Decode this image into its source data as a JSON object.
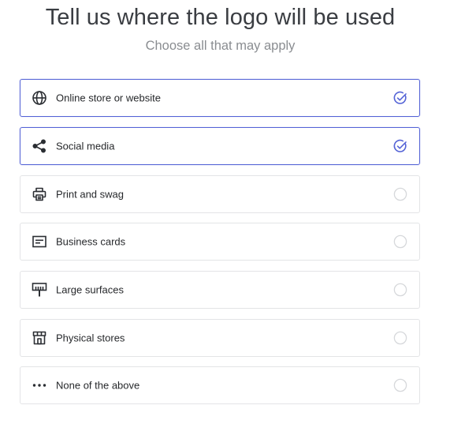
{
  "header": {
    "title": "Tell us where the logo will be used",
    "subtitle": "Choose all that may apply"
  },
  "colors": {
    "accent": "#5463d6",
    "border": "#e3e4e6",
    "icon": "#2b2e33",
    "unchecked": "#d6d8db"
  },
  "options": [
    {
      "label": "Online store or website",
      "icon": "globe-icon",
      "selected": true
    },
    {
      "label": "Social media",
      "icon": "share-icon",
      "selected": true
    },
    {
      "label": "Print and swag",
      "icon": "printer-icon",
      "selected": false
    },
    {
      "label": "Business cards",
      "icon": "business-card-icon",
      "selected": false
    },
    {
      "label": "Large surfaces",
      "icon": "billboard-icon",
      "selected": false
    },
    {
      "label": "Physical stores",
      "icon": "storefront-icon",
      "selected": false
    },
    {
      "label": "None of the above",
      "icon": "more-dots-icon",
      "selected": false
    }
  ]
}
